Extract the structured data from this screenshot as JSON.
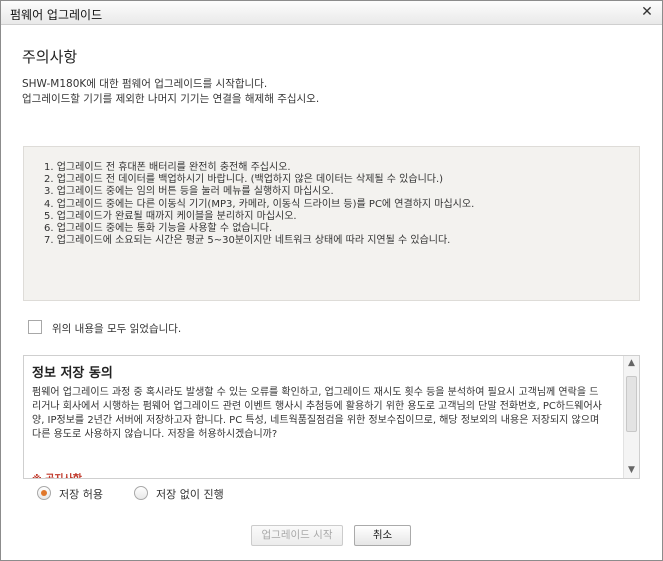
{
  "window": {
    "title": "펌웨어 업그레이드",
    "close_glyph": "✕"
  },
  "header": {
    "title": "주의사항",
    "desc_line1": "SHW-M180K에 대한 펌웨어 업그레이드를 시작합니다.",
    "desc_line2": "업그레이드할 기기를 제외한 나머지 기기는 연결을 해제해 주십시오."
  },
  "notices": [
    "1. 업그레이드 전 휴대폰 배터리를 완전히 충전해 주십시오.",
    "2. 업그레이드 전 데이터를 백업하시기 바랍니다. (백업하지 않은 데이터는 삭제될 수 있습니다.)",
    "3. 업그레이드 중에는 임의 버튼 등을 눌러 메뉴를 실행하지 마십시오.",
    "4. 업그레이드 중에는 다른 이동식 기기(MP3, 카메라, 이동식 드라이브 등)를 PC에 연결하지 마십시오.",
    "5. 업그레이드가 완료될 때까지 케이블을 분리하지 마십시오.",
    "6. 업그레이드 중에는 통화 기능을 사용할 수 없습니다.",
    "7. 업그레이드에 소요되는 시간은 평균 5~30분이지만 네트워크 상태에 따라 지연될 수 있습니다."
  ],
  "agree": {
    "label": "위의 내용을 모두 읽었습니다.",
    "checked": false
  },
  "consent": {
    "title": "정보 저장 동의",
    "text": "펌웨어 업그레이드 과정 중 혹시라도 발생할 수 있는 오류를 확인하고, 업그레이드 재시도 횟수 등을 분석하여 필요시 고객님께 연락을 드리거나 회사에서 시행하는 펌웨어 업그레이드 관련 이벤트 행사시 추첨등에 활용하기 위한 용도로 고객님의 단말 전화번호, PC하드웨어사양, IP정보를 2년간 서버에 저장하고자 합니다. PC 특성, 네트웍품질점검을 위한 정보수집이므로, 해당 정보외의 내용은 저장되지 않으며 다른 용도로 사용하지 않습니다. 저장을 허용하시겠습니까?",
    "notice_heading": "※ 공지사항",
    "scroll_up_glyph": "▲",
    "scroll_down_glyph": "▼"
  },
  "options": {
    "allow_label": "저장 허용",
    "deny_label": "저장 없이 진행",
    "selected": "allow"
  },
  "buttons": {
    "start_label": "업그레이드 시작",
    "start_enabled": false,
    "cancel_label": "취소"
  }
}
